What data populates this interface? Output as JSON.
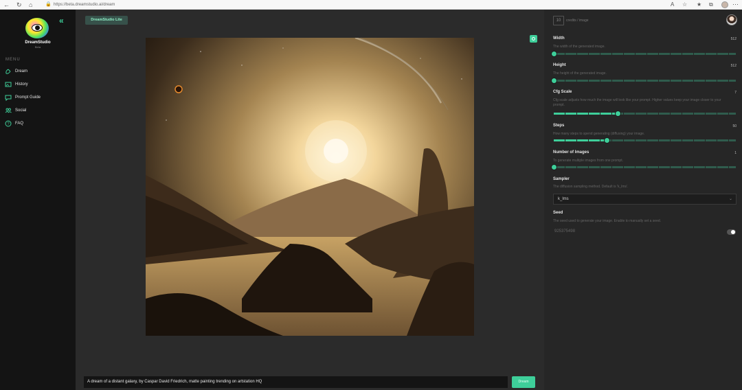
{
  "browser": {
    "url": "https://beta.dreamstudio.ai/dream"
  },
  "sidebar": {
    "brand": "DreamStudio",
    "brand_sub": "Beta",
    "menu_title": "MENU",
    "items": [
      {
        "label": "Dream",
        "icon": "brush-icon"
      },
      {
        "label": "History",
        "icon": "image-icon"
      },
      {
        "label": "Prompt Guide",
        "icon": "chat-icon"
      },
      {
        "label": "Social",
        "icon": "people-icon"
      },
      {
        "label": "FAQ",
        "icon": "help-icon"
      }
    ]
  },
  "header": {
    "pill_label": "DreamStudio Lite"
  },
  "credits": {
    "value": "10",
    "label": "credits / image"
  },
  "settings": {
    "width": {
      "label": "Width",
      "value": "512",
      "desc": "The width of the generated image.",
      "fraction": 0
    },
    "height": {
      "label": "Height",
      "value": "512",
      "desc": "The height of the generated image.",
      "fraction": 0
    },
    "cfg": {
      "label": "Cfg Scale",
      "value": "7",
      "desc": "Cfg scale adjusts how much the image will look like your prompt. Higher values keep your image closer to your prompt.",
      "fraction": 0.35
    },
    "steps": {
      "label": "Steps",
      "value": "50",
      "desc": "How many steps to spend generating (diffusing) your image.",
      "fraction": 0.29
    },
    "num_images": {
      "label": "Number of Images",
      "value": "1",
      "desc": "To generate multiple images from one prompt.",
      "fraction": 0
    },
    "sampler": {
      "label": "Sampler",
      "desc": "The diffusion sampling method. Default is 'k_lms'.",
      "value": "k_lms"
    },
    "seed": {
      "label": "Seed",
      "desc": "The seed used to generate your image. Enable to manually set a seed.",
      "value": "925375498"
    }
  },
  "prompt": {
    "value": "A dream of a distant galaxy, by Caspar David Friedrich, matte painting trending on artstation HQ",
    "button_label": "Dream"
  },
  "colors": {
    "accent": "#3ecf9a",
    "sidebar_bg": "#141414",
    "main_bg": "#2b2b2b",
    "panel_bg": "#262626"
  }
}
